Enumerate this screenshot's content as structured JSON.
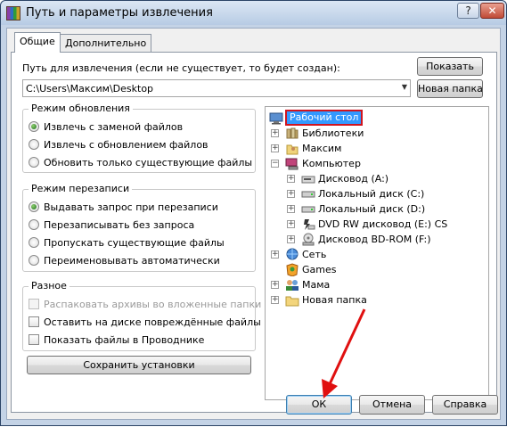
{
  "window": {
    "title": "Путь и параметры извлечения",
    "help_label": "?",
    "close_label": "✕"
  },
  "tabs": [
    {
      "label": "Общие",
      "active": true
    },
    {
      "label": "Дополнительно",
      "active": false
    }
  ],
  "path": {
    "label": "Путь для извлечения (если не существует, то будет создан):",
    "value": "C:\\Users\\Максим\\Desktop",
    "show_button": "Показать",
    "new_folder_button": "Новая папка"
  },
  "update_mode": {
    "title": "Режим обновления",
    "options": [
      {
        "label": "Извлечь с заменой файлов",
        "selected": true
      },
      {
        "label": "Извлечь с обновлением файлов",
        "selected": false
      },
      {
        "label": "Обновить только существующие файлы",
        "selected": false
      }
    ]
  },
  "overwrite_mode": {
    "title": "Режим перезаписи",
    "options": [
      {
        "label": "Выдавать запрос при перезаписи",
        "selected": true
      },
      {
        "label": "Перезаписывать без запроса",
        "selected": false
      },
      {
        "label": "Пропускать существующие файлы",
        "selected": false
      },
      {
        "label": "Переименовывать автоматически",
        "selected": false
      }
    ]
  },
  "misc": {
    "title": "Разное",
    "checks": [
      {
        "label": "Распаковать архивы во вложенные папки",
        "checked": false,
        "disabled": true
      },
      {
        "label": "Оставить на диске повреждённые файлы",
        "checked": false,
        "disabled": false
      },
      {
        "label": "Показать файлы в Проводнике",
        "checked": false,
        "disabled": false
      }
    ]
  },
  "save_settings_button": "Сохранить установки",
  "tree": {
    "nodes": [
      {
        "label": "Рабочий стол",
        "icon": "desktop-icon",
        "selected": true
      },
      {
        "label": "Библиотеки",
        "icon": "libraries-icon"
      },
      {
        "label": "Максим",
        "icon": "user-folder-icon"
      },
      {
        "label": "Компьютер",
        "icon": "computer-icon"
      },
      {
        "label": "Дисковод (A:)",
        "icon": "floppy-drive-icon"
      },
      {
        "label": "Локальный диск (C:)",
        "icon": "hard-drive-icon"
      },
      {
        "label": "Локальный диск (D:)",
        "icon": "hard-drive-icon"
      },
      {
        "label": "DVD RW дисковод (E:) CS",
        "icon": "dvd-drive-icon"
      },
      {
        "label": "Дисковод BD-ROM (F:)",
        "icon": "bd-rom-drive-icon"
      },
      {
        "label": "Сеть",
        "icon": "network-icon"
      },
      {
        "label": "Games",
        "icon": "games-icon"
      },
      {
        "label": "Мама",
        "icon": "user-group-icon"
      },
      {
        "label": "Новая папка",
        "icon": "folder-icon"
      }
    ]
  },
  "footer": {
    "ok": "ОК",
    "cancel": "Отмена",
    "help": "Справка"
  },
  "colors": {
    "selection": "#3399ff",
    "highlight_outline": "#d0141e",
    "annotation_arrow": "#e01010"
  }
}
